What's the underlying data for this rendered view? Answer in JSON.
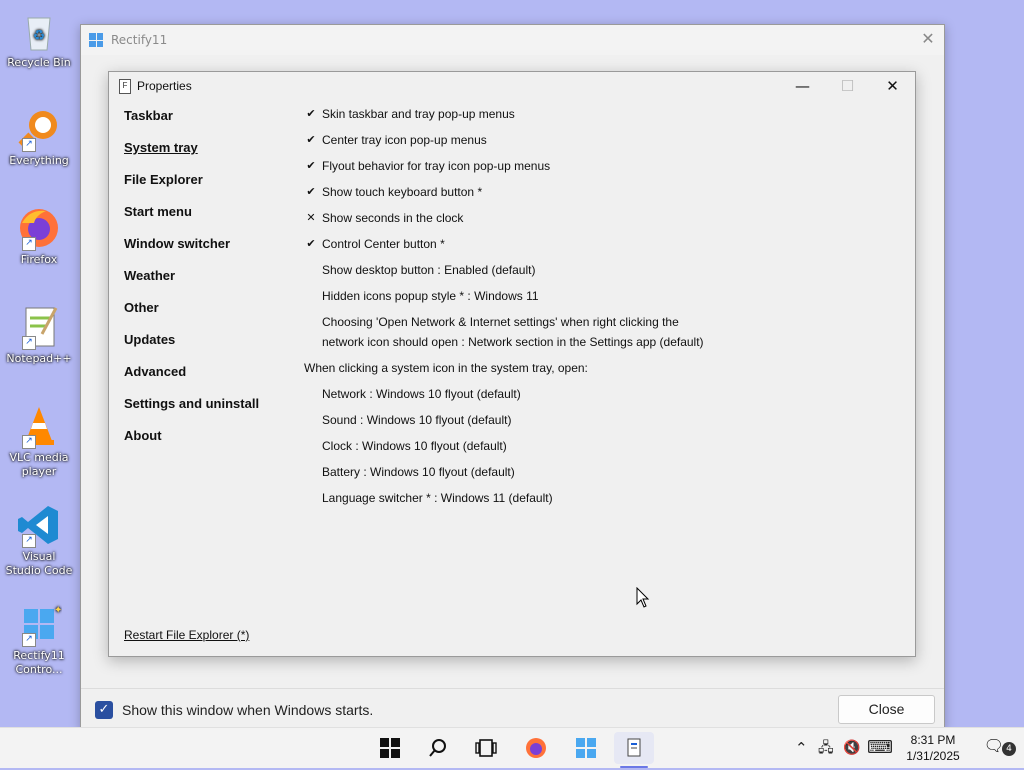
{
  "desktop": {
    "icons": [
      {
        "label": "Recycle Bin",
        "icon": "recycle-bin-icon"
      },
      {
        "label": "Everything",
        "icon": "everything-search-icon"
      },
      {
        "label": "Firefox",
        "icon": "firefox-icon"
      },
      {
        "label": "Notepad++",
        "icon": "notepadpp-icon"
      },
      {
        "label": "VLC media player",
        "icon": "vlc-icon"
      },
      {
        "label": "Visual Studio Code",
        "icon": "vscode-icon"
      },
      {
        "label": "Rectify11 Contro...",
        "icon": "rectify11-icon"
      }
    ]
  },
  "outer_window": {
    "title": "Rectify11",
    "close_glyph": "✕",
    "startup_checkbox_label": "Show this window when Windows starts.",
    "startup_checked": true,
    "close_button": "Close"
  },
  "properties": {
    "title": "Properties",
    "nav": [
      "Taskbar",
      "System tray",
      "File Explorer",
      "Start menu",
      "Window switcher",
      "Weather",
      "Other",
      "Updates",
      "Advanced",
      "Settings and uninstall",
      "About"
    ],
    "active_nav": "System tray",
    "restart_link": "Restart File Explorer (*)",
    "settings": [
      {
        "mark": "✔",
        "text": "Skin taskbar and tray pop-up menus"
      },
      {
        "mark": "✔",
        "text": "Center tray icon pop-up menus"
      },
      {
        "mark": "✔",
        "text": "Flyout behavior for tray icon pop-up menus"
      },
      {
        "mark": "✔",
        "text": "Show touch keyboard button *"
      },
      {
        "mark": "✕",
        "text": "Show seconds in the clock"
      },
      {
        "mark": "✔",
        "text": "Control Center button *"
      },
      {
        "mark": "",
        "text": "Show desktop button : Enabled (default)"
      },
      {
        "mark": "",
        "text": "Hidden icons popup style * : Windows 11"
      },
      {
        "mark": "",
        "text_line1": "Choosing 'Open Network & Internet settings' when right clicking the",
        "text_line2": "network icon should open : Network section in the Settings app (default)"
      }
    ],
    "tray_open_header": "When clicking a system icon in the system tray, open:",
    "tray_open_items": [
      "Network : Windows 10 flyout (default)",
      "Sound : Windows 10 flyout (default)",
      "Clock : Windows 10 flyout (default)",
      "Battery : Windows 10 flyout (default)",
      "Language switcher * : Windows 11 (default)"
    ]
  },
  "taskbar": {
    "time": "8:31 PM",
    "date": "1/31/2025",
    "notification_count": "4",
    "accent": "#6b78e6"
  }
}
